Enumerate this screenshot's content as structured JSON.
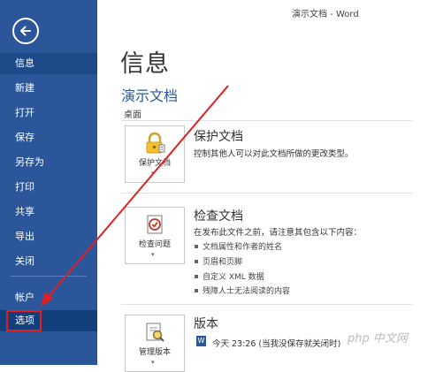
{
  "window": {
    "title": "演示文档 - Word"
  },
  "sidebar": {
    "items": [
      {
        "label": "信息"
      },
      {
        "label": "新建"
      },
      {
        "label": "打开"
      },
      {
        "label": "保存"
      },
      {
        "label": "另存为"
      },
      {
        "label": "打印"
      },
      {
        "label": "共享"
      },
      {
        "label": "导出"
      },
      {
        "label": "关闭"
      },
      {
        "label": "帐户"
      },
      {
        "label": "选项"
      }
    ],
    "active_item": "信息",
    "highlighted_item": "选项"
  },
  "main": {
    "title": "信息",
    "doc_name": "演示文档",
    "doc_location": "桌面",
    "protect": {
      "button_label": "保护文档",
      "title": "保护文档",
      "description": "控制其他人可以对此文档所做的更改类型。"
    },
    "inspect": {
      "button_label": "检查问题",
      "title": "检查文档",
      "description": "在发布此文件之前，请注意其包含以下内容：",
      "bullets": [
        "文档属性和作者的姓名",
        "页眉和页脚",
        "自定义 XML 数据",
        "残障人士无法阅读的内容"
      ]
    },
    "versions": {
      "button_label": "管理版本",
      "title": "版本",
      "entry": "今天 23:26 (当我没保存就关闭时)"
    }
  },
  "watermark": "php 中文网",
  "colors": {
    "sidebar": "#2b579a",
    "sidebar_active": "#1f4a8a",
    "annotation": "#e02020",
    "accent_text": "#2b579a"
  },
  "icons": {
    "back": "back-arrow-icon",
    "protect": "lock-icon",
    "inspect": "document-check-icon",
    "versions": "document-magnifier-icon",
    "word": "word-icon"
  }
}
